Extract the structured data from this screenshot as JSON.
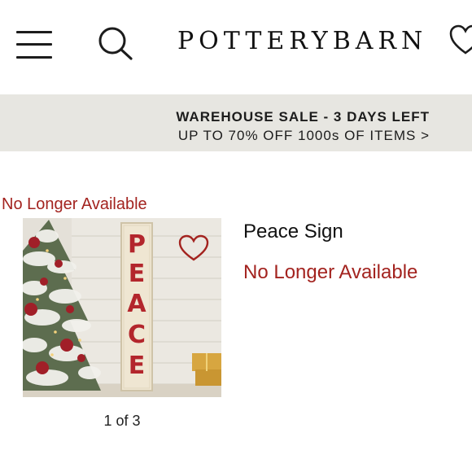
{
  "header": {
    "logo": "POTTERYBARN",
    "icons": [
      "hamburger-menu-icon",
      "search-icon",
      "heart-icon"
    ]
  },
  "banner": {
    "headline": "WAREHOUSE SALE - 3 DAYS LEFT",
    "subline": "UP TO 70% OFF 1000s OF ITEMS >"
  },
  "product": {
    "availability_label": "No Longer Available",
    "name": "Peace Sign",
    "status": "No Longer Available",
    "image_pager": "1 of 3",
    "image_sign_text": "PEACE",
    "favorite_icon": "heart-outline-icon"
  },
  "colors": {
    "alert_red": "#a3231f",
    "banner_bg": "#e7e6e1",
    "sign_red": "#b3262c"
  }
}
